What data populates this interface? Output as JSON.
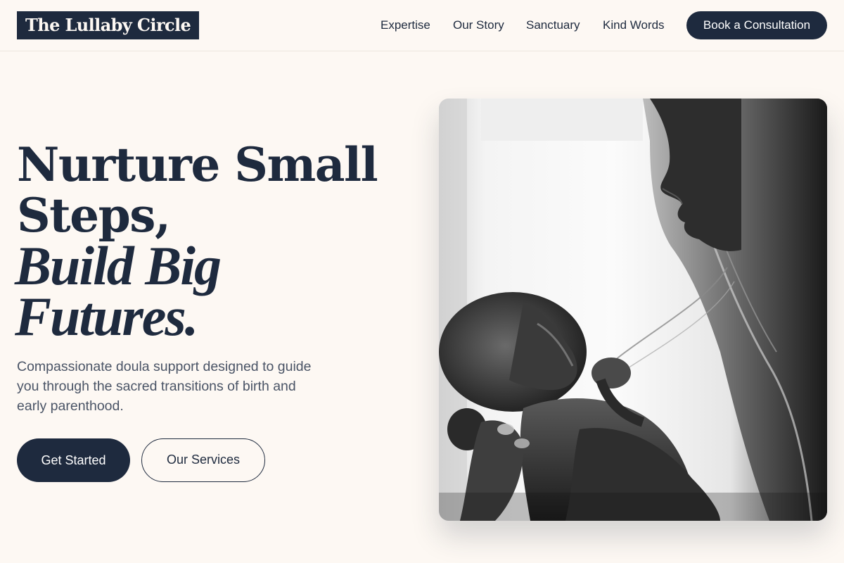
{
  "header": {
    "logo": "The Lullaby Circle",
    "nav": [
      {
        "label": "Expertise"
      },
      {
        "label": "Our Story"
      },
      {
        "label": "Sanctuary"
      },
      {
        "label": "Kind Words"
      }
    ],
    "cta_label": "Book a Consultation"
  },
  "hero": {
    "headline_line1": "Nurture Small",
    "headline_line2": "Steps,",
    "headline_line3": "Build Big",
    "headline_line4": "Futures.",
    "subtext": "Compassionate doula support designed to guide you through the sacred transitions of birth and early parenthood.",
    "primary_button": "Get Started",
    "secondary_button": "Our Services"
  },
  "colors": {
    "background": "#fdf8f3",
    "navy": "#1e2a3e",
    "body_text": "#4a5466"
  }
}
